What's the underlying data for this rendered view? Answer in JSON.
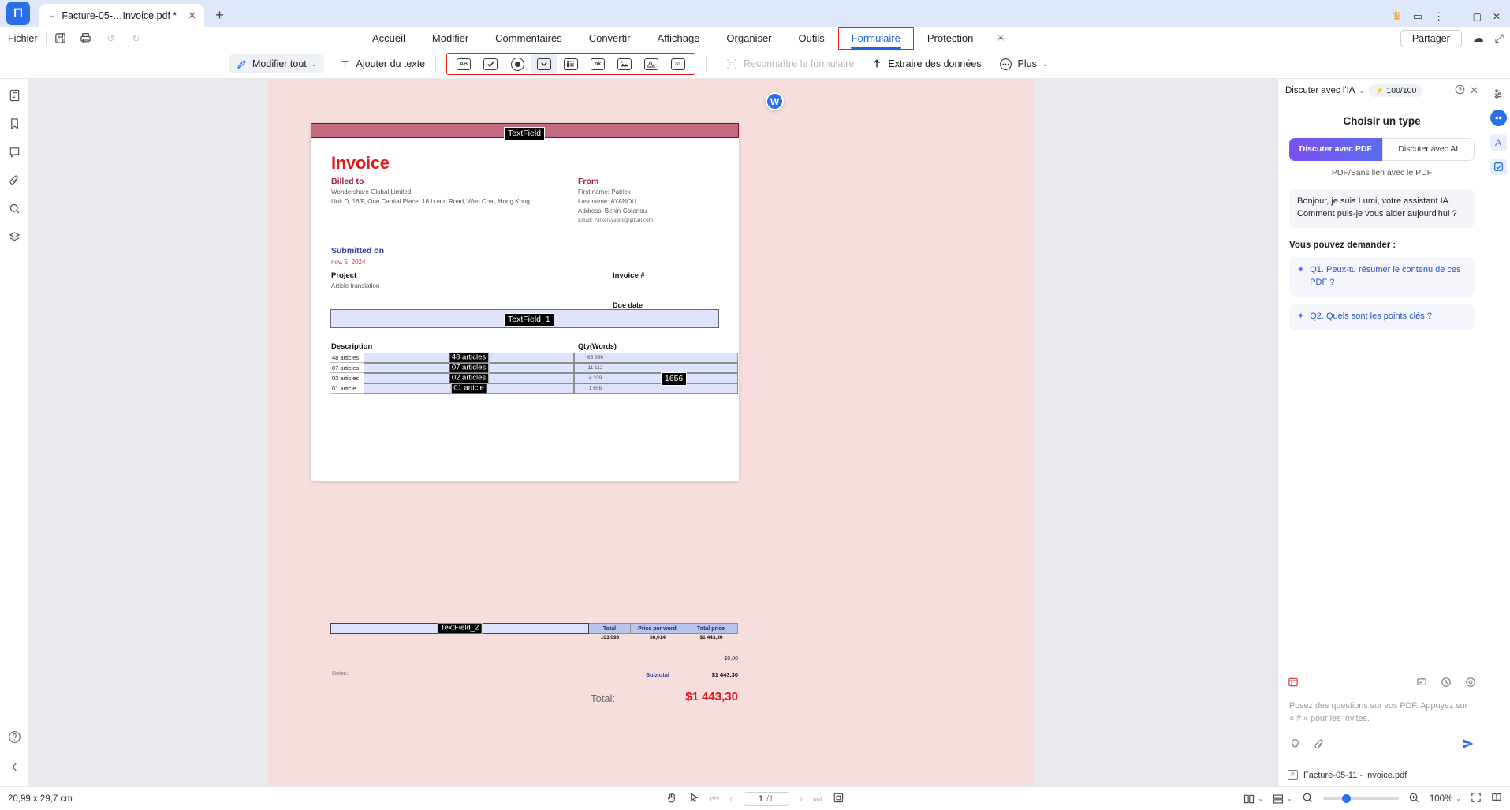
{
  "titlebar": {
    "logo": "pdf-logo",
    "tab_name": "Facture-05-…Invoice.pdf *",
    "tab_chevron": "⌄",
    "tab_close": "✕",
    "new_tab": "+",
    "crown_icon": "♛",
    "comment_icon": "▭",
    "more_icon": "⋮",
    "minimize": "─",
    "maximize": "▢",
    "close": "✕"
  },
  "menurow": {
    "fichier": "Fichier",
    "save_icon": "save-icon",
    "print_icon": "print-icon",
    "undo_icon": "↺",
    "redo_icon": "↻",
    "tabs": [
      {
        "label": "Accueil",
        "active": false
      },
      {
        "label": "Modifier",
        "active": false
      },
      {
        "label": "Commentaires",
        "active": false
      },
      {
        "label": "Convertir",
        "active": false
      },
      {
        "label": "Affichage",
        "active": false
      },
      {
        "label": "Organiser",
        "active": false
      },
      {
        "label": "Outils",
        "active": false
      },
      {
        "label": "Formulaire",
        "active": true
      },
      {
        "label": "Protection",
        "active": false
      }
    ],
    "bulb_icon": "☀",
    "share_label": "Partager",
    "cloud_icon": "☁",
    "expand_icon": "⤢"
  },
  "toolbar": {
    "modifier_tout": "Modifier tout",
    "modifier_chevron": "⌄",
    "ajouter_texte": "Ajouter du texte",
    "text_icon": "T",
    "fields": [
      {
        "name": "text-field-tool",
        "glyph": "AB",
        "selected": false
      },
      {
        "name": "checkbox-field-tool",
        "glyph": "✔",
        "selected": false
      },
      {
        "name": "radio-button-field-tool",
        "glyph": "●",
        "selected": false
      },
      {
        "name": "combo-box-field-tool",
        "glyph": "⌄",
        "selected": true
      },
      {
        "name": "list-box-field-tool",
        "glyph": "≔",
        "selected": false
      },
      {
        "name": "push-button-field-tool",
        "glyph": "ok",
        "selected": false
      },
      {
        "name": "image-field-tool",
        "glyph": "▣",
        "selected": false
      },
      {
        "name": "signature-field-tool",
        "glyph": "✎",
        "selected": false
      },
      {
        "name": "date-field-tool",
        "glyph": "31",
        "selected": false
      }
    ],
    "reconnaitre": "Reconnaître le formulaire",
    "extraire": "Extraire des données",
    "extraire_icon": "↑",
    "plus": "Plus",
    "plus_icon": "•••",
    "plus_chevron": "⌄"
  },
  "left_rail": [
    {
      "name": "sidebar-thumbnails",
      "icon": "▤"
    },
    {
      "name": "sidebar-bookmarks",
      "icon": "🔖"
    },
    {
      "name": "sidebar-comments",
      "icon": "▢"
    },
    {
      "name": "sidebar-attachments",
      "icon": "📎"
    },
    {
      "name": "sidebar-search",
      "icon": "🔍"
    },
    {
      "name": "sidebar-layers",
      "icon": "◈"
    }
  ],
  "left_rail_bottom": [
    {
      "name": "help-button",
      "icon": "?"
    },
    {
      "name": "collapse-sidebar-button",
      "icon": "‹"
    }
  ],
  "document": {
    "top_field_tag": "TextField",
    "title": "Invoice",
    "billed_to_label": "Billed to",
    "billed_to_name": "Wondershare Global Limited",
    "billed_to_address": "Unit D, 16/F, One Capital Place, 18 Luard Road, Wan Chai, Hong Kong",
    "from_label": "From",
    "from_first": "First name: Patrick",
    "from_last": "Last name: AYANOU",
    "from_address": "Address: Benin-Cotonou",
    "from_email": "Email: Parkerayanou@gmail.com",
    "submitted_label": "Submitted on",
    "submitted_date": "nov. 5, 2024",
    "project_label": "Project",
    "project_value": "Article translation",
    "invoice_num_label": "Invoice #",
    "due_date_label": "Due date",
    "wide_field_tag": "TextField_1",
    "desc_header": "Description",
    "qty_header": "Qty(Words)",
    "rows": [
      {
        "desc": "48 articles",
        "field_tag": "48 articles",
        "qty": "85 986"
      },
      {
        "desc": "07 articles",
        "field_tag": "07 articles",
        "qty": "11 112"
      },
      {
        "desc": "02 articles",
        "field_tag": "02 articles",
        "qty": "4 339"
      },
      {
        "desc": "01 article",
        "field_tag": "01 article",
        "qty": "1 656"
      }
    ],
    "floating_tag": "1656",
    "total_field_tag": "TextField_2",
    "total_header": "Total",
    "price_header": "Price per word",
    "total_price_header": "Total price",
    "total_qty": "103 093",
    "price_per_word": "$0,014",
    "total_price": "$1 443,30",
    "zero_value": "$0,00",
    "notes_label": "Notes:",
    "subtotal_label": "Subtotal",
    "subtotal_value": "$1 443,30",
    "grand_label": "Total:",
    "grand_value": "$1 443,30",
    "word_badge": "W"
  },
  "ai_panel": {
    "selector_label": "Discuter avec l'IA",
    "selector_chevron": "⌄",
    "credits": "100/100",
    "bolt": "⚡",
    "help_icon": "?",
    "close_icon": "✕",
    "choose_type": "Choisir un type",
    "toggle_pdf": "Discuter avec PDF",
    "toggle_ai": "Discuter avec AI",
    "hint": "PDF/Sans lien avec le PDF",
    "greeting": "Bonjour, je suis Lumi, votre assistant IA. Comment puis-je vous aider aujourd'hui ?",
    "ask_title": "Vous pouvez demander :",
    "questions": [
      "Q1. Peux-tu résumer le contenu de ces PDF ?",
      "Q2. Quels sont les points clés ?"
    ],
    "spark": "✦",
    "tool_library": "library-icon",
    "tool_note": "note-icon",
    "tool_history": "history-icon",
    "tool_settings": "settings-icon",
    "input_placeholder": "Posez des questions sur vos PDF. Appuyez sur « # » pour les invites.",
    "lightbulb_icon": "💡",
    "attach_icon": "📎",
    "send_icon": "➤",
    "file_name": "Facture-05-11 - Invoice.pdf"
  },
  "right_rail": [
    {
      "name": "ai-assistant-icon",
      "icon": "◉",
      "style": "blue"
    },
    {
      "name": "ocr-icon",
      "icon": "A",
      "style": "sq-blue"
    },
    {
      "name": "form-check-icon",
      "icon": "☑",
      "style": "sq-blue"
    }
  ],
  "right_rail_top": {
    "name": "settings-icon",
    "icon": "⚙"
  },
  "statusbar": {
    "dimensions": "20,99 x 29,7 cm",
    "hand_icon": "✋",
    "select_icon": "⌖",
    "first_page_icon": "⏮",
    "prev_page_icon": "‹",
    "current_page": "1",
    "total_pages": "/1",
    "next_page_icon": "›",
    "last_page_icon": "⏭",
    "fit_icon": "▭",
    "layout_icon": "▥",
    "layout_chevron": "⌄",
    "view_icon": "▤",
    "view_chevron": "⌄",
    "zoom_out": "−",
    "zoom_in": "+",
    "zoom_level": "100%",
    "zoom_chevron": "⌄",
    "fullscreen_icon": "⛶",
    "readmode_icon": "▦"
  }
}
